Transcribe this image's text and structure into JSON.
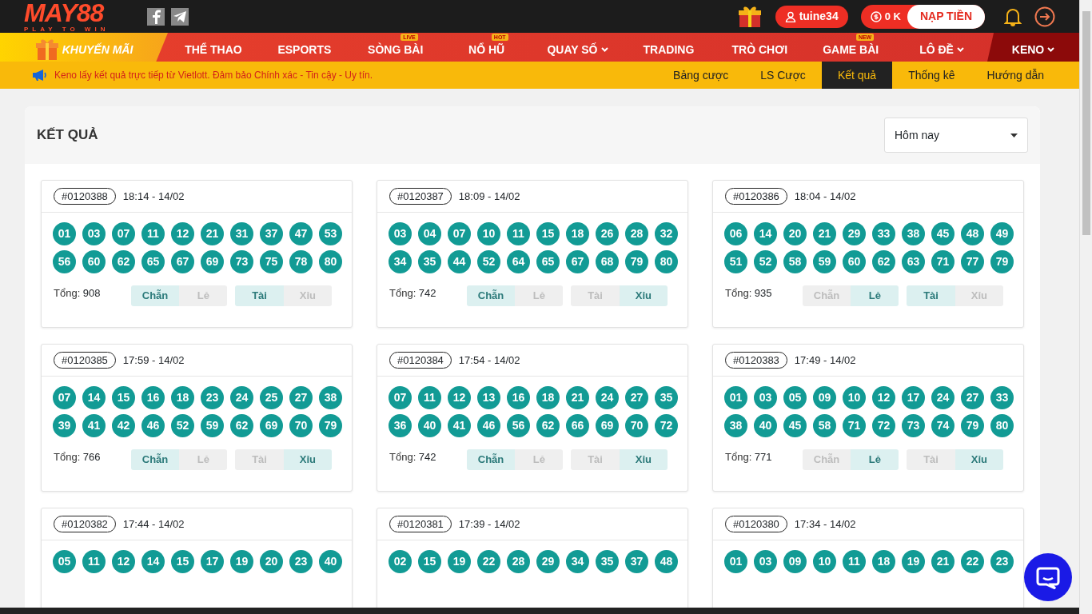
{
  "header": {
    "logo": "MAY88",
    "slogan": "PLAY TO WIN",
    "username": "tuine34",
    "balance": "0 K",
    "deposit": "NẠP TIỀN"
  },
  "nav": [
    {
      "label": "KHUYẾN MÃI",
      "kind": "promo",
      "selected": false
    },
    {
      "label": "THỂ THAO",
      "kind": "item",
      "selected": false
    },
    {
      "label": "ESPORTS",
      "kind": "item",
      "selected": false
    },
    {
      "label": "SÒNG BÀI",
      "kind": "item",
      "badge": "LIVE",
      "selected": false
    },
    {
      "label": "NỔ HŨ",
      "kind": "item",
      "badge": "HOT",
      "selected": false
    },
    {
      "label": "QUAY SỐ",
      "kind": "item",
      "dropdown": true,
      "selected": false
    },
    {
      "label": "TRADING",
      "kind": "item",
      "selected": false
    },
    {
      "label": "TRÒ CHƠI",
      "kind": "item",
      "selected": false
    },
    {
      "label": "GAME BÀI",
      "kind": "item",
      "badge": "NEW",
      "selected": false
    },
    {
      "label": "LÔ ĐỀ",
      "kind": "item",
      "dropdown": true,
      "selected": false
    },
    {
      "label": "KENO",
      "kind": "item",
      "dropdown": true,
      "selected": true
    }
  ],
  "notice": "Keno lấy kết quả trực tiếp từ Vietlott. Đảm bảo Chính xác - Tin cậy - Uy tín.",
  "tabs": [
    {
      "label": "Bảng cược",
      "selected": false
    },
    {
      "label": "LS Cược",
      "selected": false
    },
    {
      "label": "Kết quả",
      "selected": true
    },
    {
      "label": "Thống kê",
      "selected": false
    },
    {
      "label": "Hướng dẫn",
      "selected": false
    }
  ],
  "panel": {
    "title": "KẾT QUẢ",
    "filter": "Hôm nay"
  },
  "results": [
    {
      "id": "#0120388",
      "time": "18:14 - 14/02",
      "numbers": [
        "01",
        "03",
        "07",
        "11",
        "12",
        "21",
        "31",
        "37",
        "47",
        "53",
        "56",
        "60",
        "62",
        "65",
        "67",
        "69",
        "73",
        "75",
        "78",
        "80"
      ],
      "total_label": "Tổng:",
      "total": "908",
      "parity": [
        {
          "label": "Chẵn",
          "selected": true
        },
        {
          "label": "Lẻ",
          "selected": false
        }
      ],
      "size": [
        {
          "label": "Tài",
          "selected": true
        },
        {
          "label": "Xỉu",
          "selected": false
        }
      ]
    },
    {
      "id": "#0120387",
      "time": "18:09 - 14/02",
      "numbers": [
        "03",
        "04",
        "07",
        "10",
        "11",
        "15",
        "18",
        "26",
        "28",
        "32",
        "34",
        "35",
        "44",
        "52",
        "64",
        "65",
        "67",
        "68",
        "79",
        "80"
      ],
      "total_label": "Tổng:",
      "total": "742",
      "parity": [
        {
          "label": "Chẵn",
          "selected": true
        },
        {
          "label": "Lẻ",
          "selected": false
        }
      ],
      "size": [
        {
          "label": "Tài",
          "selected": false
        },
        {
          "label": "Xỉu",
          "selected": true
        }
      ]
    },
    {
      "id": "#0120386",
      "time": "18:04 - 14/02",
      "numbers": [
        "06",
        "14",
        "20",
        "21",
        "29",
        "33",
        "38",
        "45",
        "48",
        "49",
        "51",
        "52",
        "58",
        "59",
        "60",
        "62",
        "63",
        "71",
        "77",
        "79"
      ],
      "total_label": "Tổng:",
      "total": "935",
      "parity": [
        {
          "label": "Chẵn",
          "selected": false
        },
        {
          "label": "Lẻ",
          "selected": true
        }
      ],
      "size": [
        {
          "label": "Tài",
          "selected": true
        },
        {
          "label": "Xỉu",
          "selected": false
        }
      ]
    },
    {
      "id": "#0120385",
      "time": "17:59 - 14/02",
      "numbers": [
        "07",
        "14",
        "15",
        "16",
        "18",
        "23",
        "24",
        "25",
        "27",
        "38",
        "39",
        "41",
        "42",
        "46",
        "52",
        "59",
        "62",
        "69",
        "70",
        "79"
      ],
      "total_label": "Tổng:",
      "total": "766",
      "parity": [
        {
          "label": "Chẵn",
          "selected": true
        },
        {
          "label": "Lẻ",
          "selected": false
        }
      ],
      "size": [
        {
          "label": "Tài",
          "selected": false
        },
        {
          "label": "Xỉu",
          "selected": true
        }
      ]
    },
    {
      "id": "#0120384",
      "time": "17:54 - 14/02",
      "numbers": [
        "07",
        "11",
        "12",
        "13",
        "16",
        "18",
        "21",
        "24",
        "27",
        "35",
        "36",
        "40",
        "41",
        "46",
        "56",
        "62",
        "66",
        "69",
        "70",
        "72"
      ],
      "total_label": "Tổng:",
      "total": "742",
      "parity": [
        {
          "label": "Chẵn",
          "selected": true
        },
        {
          "label": "Lẻ",
          "selected": false
        }
      ],
      "size": [
        {
          "label": "Tài",
          "selected": false
        },
        {
          "label": "Xỉu",
          "selected": true
        }
      ]
    },
    {
      "id": "#0120383",
      "time": "17:49 - 14/02",
      "numbers": [
        "01",
        "03",
        "05",
        "09",
        "10",
        "12",
        "17",
        "24",
        "27",
        "33",
        "38",
        "40",
        "45",
        "58",
        "71",
        "72",
        "73",
        "74",
        "79",
        "80"
      ],
      "total_label": "Tổng:",
      "total": "771",
      "parity": [
        {
          "label": "Chẵn",
          "selected": false
        },
        {
          "label": "Lẻ",
          "selected": true
        }
      ],
      "size": [
        {
          "label": "Tài",
          "selected": false
        },
        {
          "label": "Xỉu",
          "selected": true
        }
      ]
    },
    {
      "id": "#0120382",
      "time": "17:44 - 14/02",
      "numbers": [
        "05",
        "11",
        "12",
        "14",
        "15",
        "17",
        "19",
        "20",
        "23",
        "40"
      ]
    },
    {
      "id": "#0120381",
      "time": "17:39 - 14/02",
      "numbers": [
        "02",
        "15",
        "19",
        "22",
        "28",
        "29",
        "34",
        "35",
        "37",
        "48"
      ]
    },
    {
      "id": "#0120380",
      "time": "17:34 - 14/02",
      "numbers": [
        "01",
        "03",
        "09",
        "10",
        "11",
        "18",
        "19",
        "21",
        "22",
        "23"
      ]
    }
  ]
}
